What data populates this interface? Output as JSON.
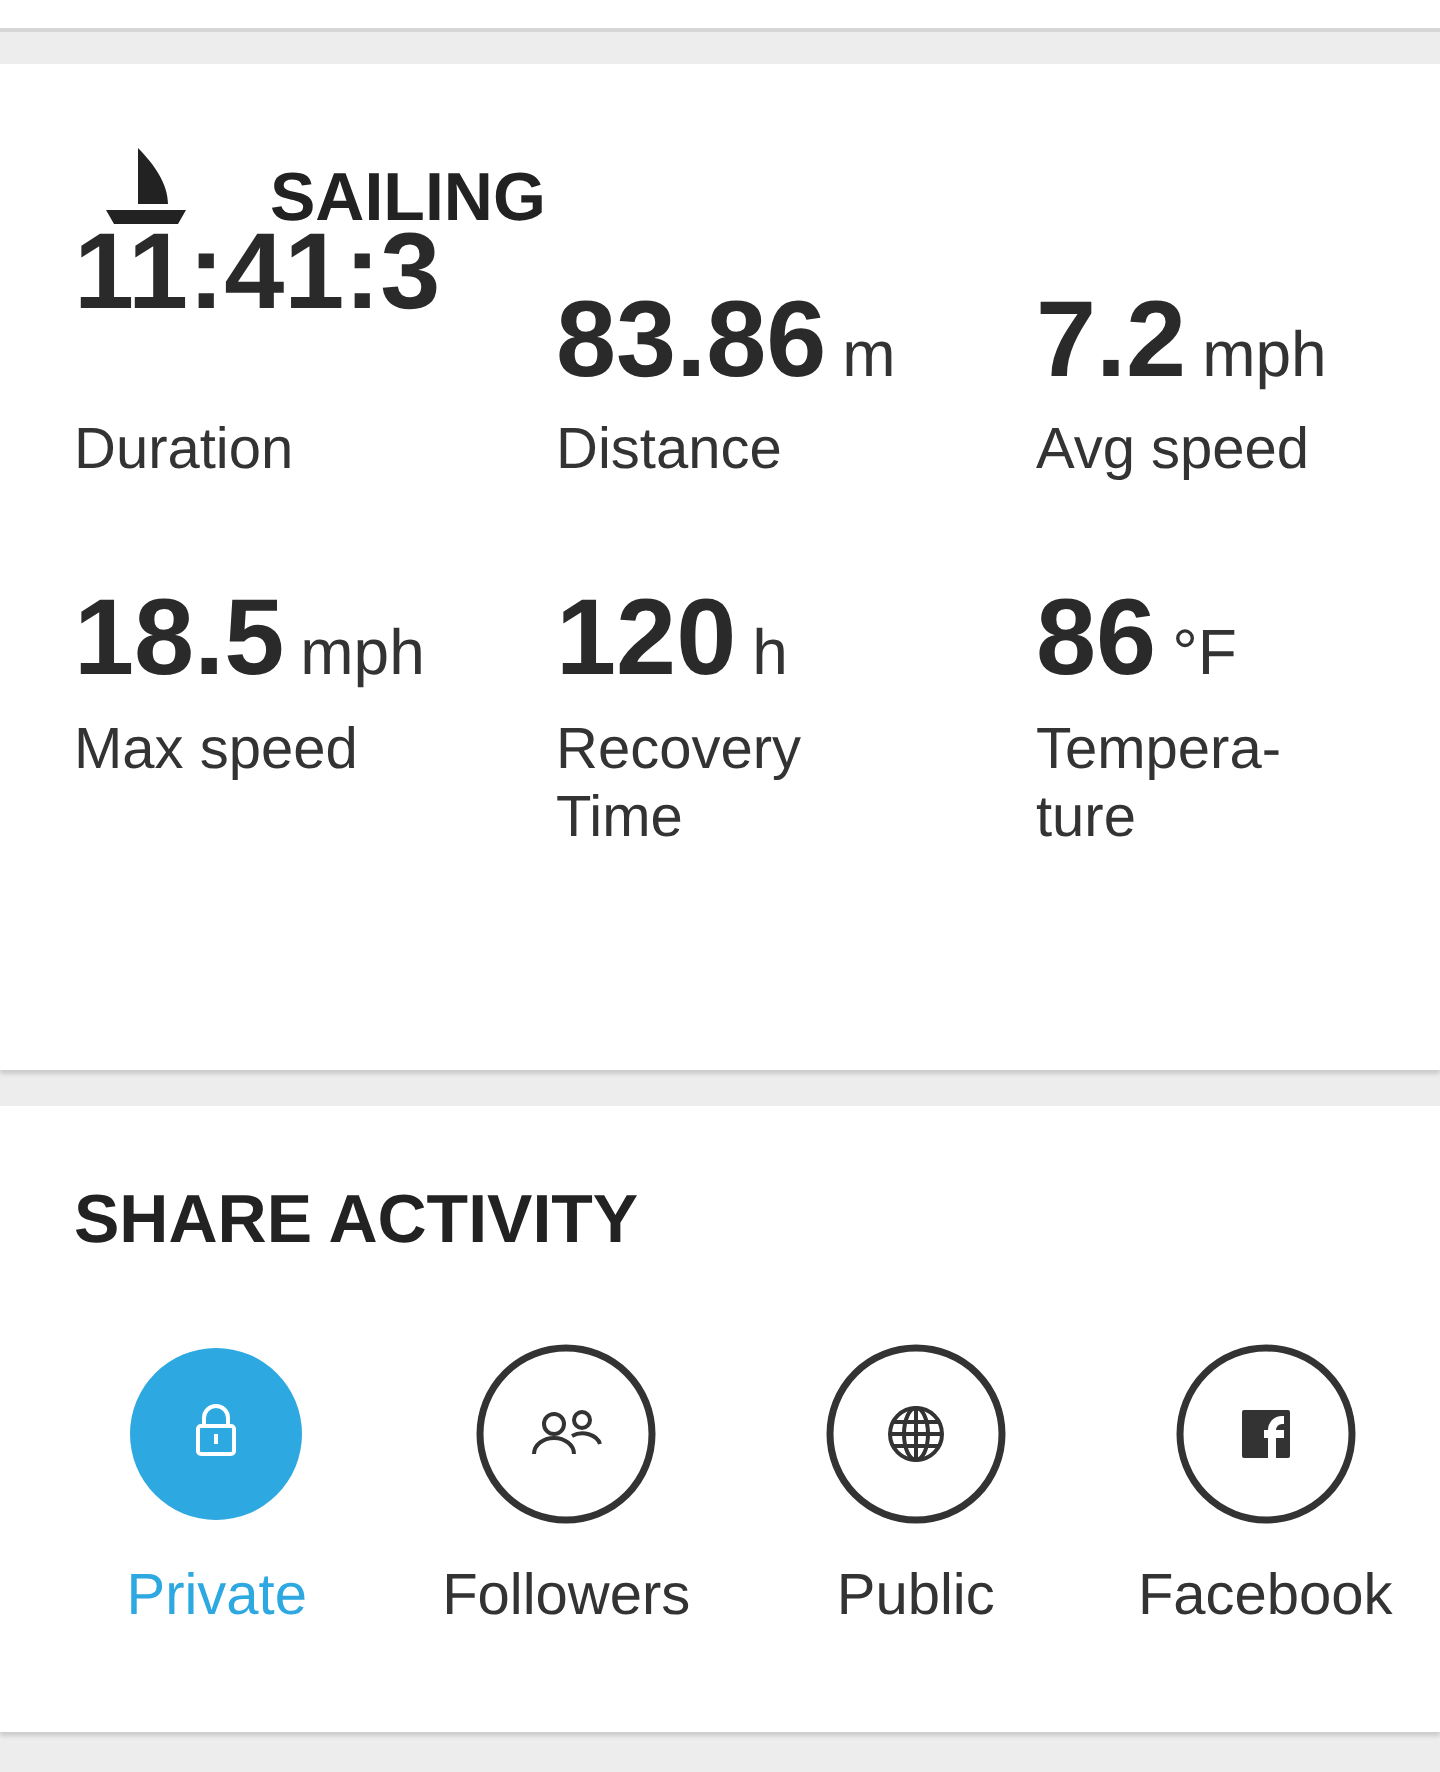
{
  "activity": {
    "title": "SAILING",
    "metrics": [
      {
        "value": "11:41:3",
        "label": "Duration"
      },
      {
        "value": "83.86",
        "unit": "m",
        "label": "Distance"
      },
      {
        "value": "7.2",
        "unit": "mph",
        "label": "Avg speed"
      },
      {
        "value": "18.5",
        "unit": "mph",
        "label": "Max speed"
      },
      {
        "value": "120",
        "unit": "h",
        "label": "Recovery Time"
      },
      {
        "value": "86",
        "unit": "°F",
        "label": "Tempera-ture"
      }
    ]
  },
  "share": {
    "title": "SHARE ACTIVITY",
    "options": [
      {
        "kind": "lock",
        "label": "Private",
        "selected": true
      },
      {
        "kind": "people",
        "label": "Followers",
        "selected": false
      },
      {
        "kind": "globe",
        "label": "Public",
        "selected": false
      },
      {
        "kind": "facebook",
        "label": "Facebook",
        "selected": false
      }
    ]
  }
}
